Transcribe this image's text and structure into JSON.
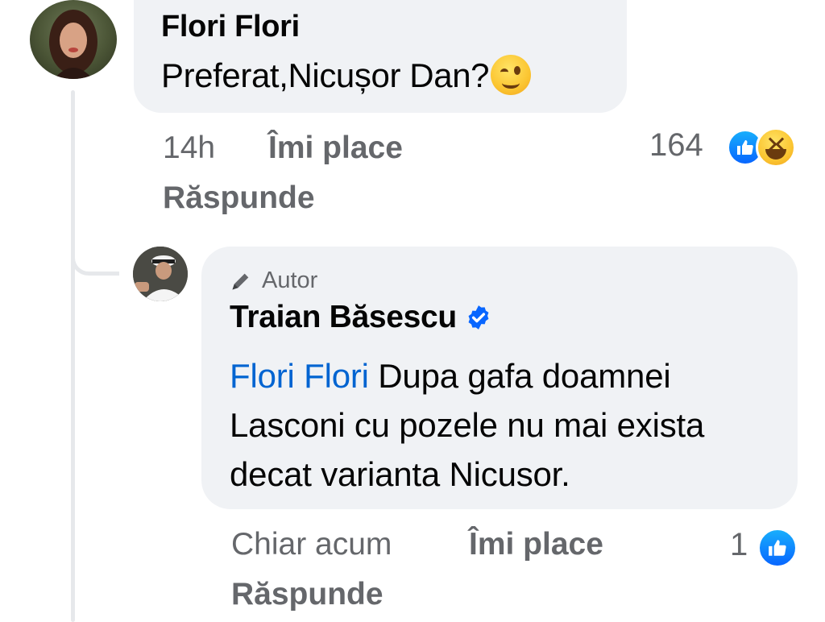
{
  "comment": {
    "author": "Flori Flori",
    "text": "Preferat,Nicușor Dan?",
    "emoji": "winking-face",
    "time": "14h",
    "like_label": "Îmi place",
    "reply_label": "Răspunde",
    "reaction_count": "164",
    "reactions": [
      "like",
      "haha"
    ]
  },
  "reply": {
    "badge_label": "Autor",
    "author": "Traian Băsescu",
    "verified": true,
    "mention": "Flori Flori",
    "text": "Dupa gafa doamnei Lasconi cu pozele nu mai exista decat varianta Nicusor.",
    "time": "Chiar acum",
    "like_label": "Îmi place",
    "reply_label": "Răspunde",
    "reaction_count": "1",
    "reactions": [
      "like"
    ]
  },
  "colors": {
    "bubble": "#f0f2f5",
    "meta_text": "#65676b",
    "mention": "#0064d1",
    "like_blue": "#0866ff",
    "verified_blue": "#0866ff"
  }
}
